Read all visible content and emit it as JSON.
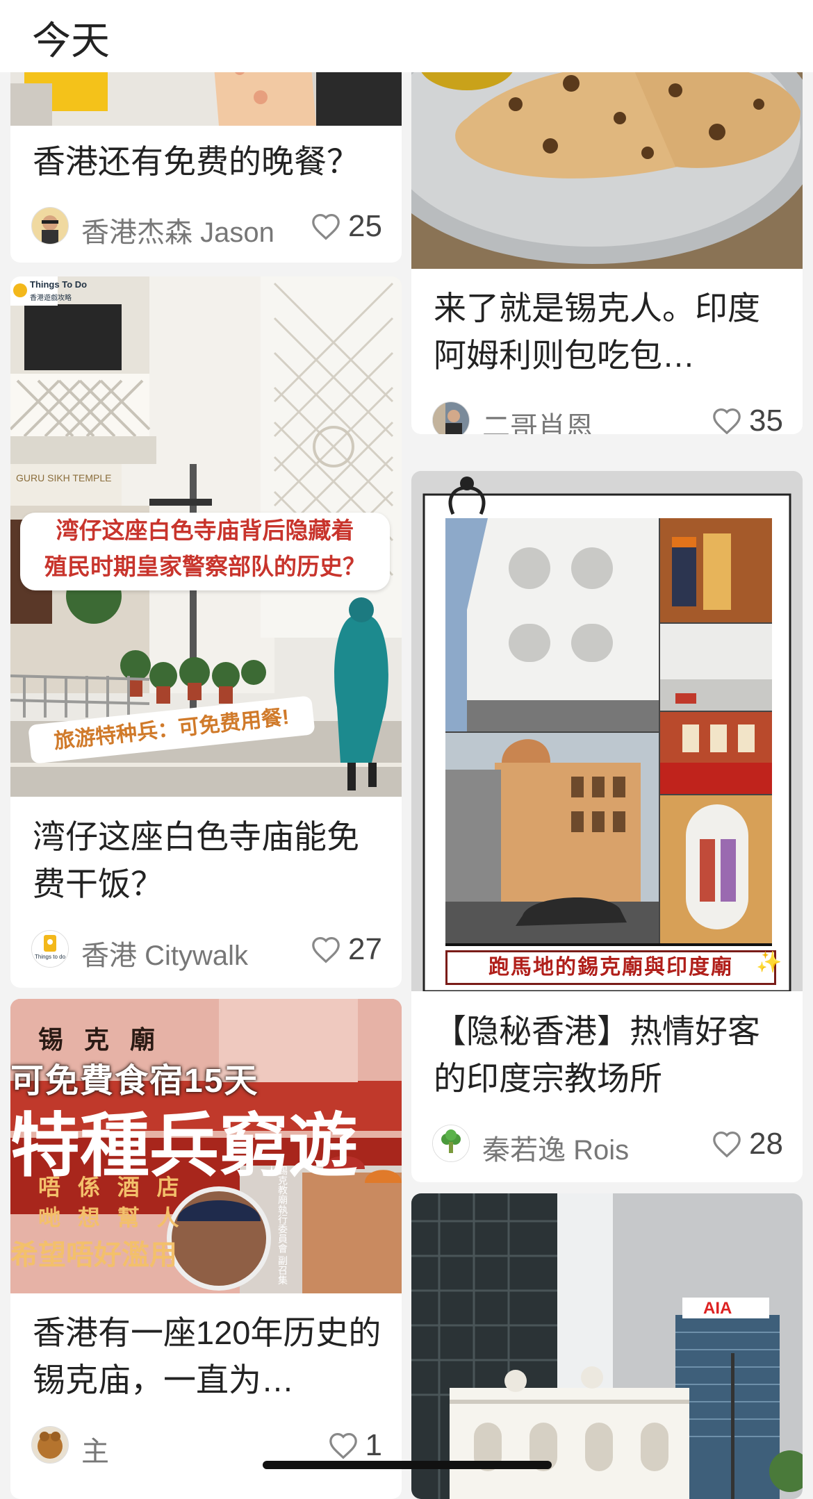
{
  "header": {
    "title": "今天"
  },
  "cards": [
    {
      "title": "香港还有免费的晚餐？",
      "author": "香港杰森 Jason",
      "likes": "25"
    },
    {
      "title": "湾仔这座白色寺庙能免费干饭？",
      "author": "香港 Citywalk",
      "likes": "27",
      "image_text": {
        "logo": "Things To Do",
        "logo_sub": "香港遊戲攻略",
        "sign": "GURU SIKH TEMPLE",
        "banner_line1": "湾仔这座白色寺庙背后隐藏着",
        "banner_line2": "殖民时期皇家警察部队的历史？",
        "tag": "旅游特种兵：可免费用餐!"
      },
      "avatar_text": "Things to do"
    },
    {
      "title": "香港有一座120年历史的锡克庙，一直为…",
      "author": "主",
      "likes": "1",
      "image_text": {
        "line1": "锡 克 廟",
        "line2": "可免費食宿15天",
        "line3": "特種兵窮遊",
        "line4": "唔 係 酒 店",
        "line5": "哋 想 幫 人",
        "line6": "希望唔好濫用",
        "side": "錫克教廟執行委員會 副召集人"
      }
    },
    {
      "title": "来了就是锡克人。印度阿姆利则包吃包…",
      "author": "二哥肖恩",
      "likes": "35"
    },
    {
      "title": "【隐秘香港】热情好客的印度宗教场所",
      "author": "秦若逸 Rois",
      "likes": "28",
      "image_text": {
        "caption": "跑馬地的錫克廟與印度廟",
        "sparkle": "✨"
      }
    },
    {
      "image_text": {
        "sign": "AIA"
      }
    }
  ],
  "colors": {
    "accent_red": "#c8342c",
    "heart": "#888888"
  }
}
